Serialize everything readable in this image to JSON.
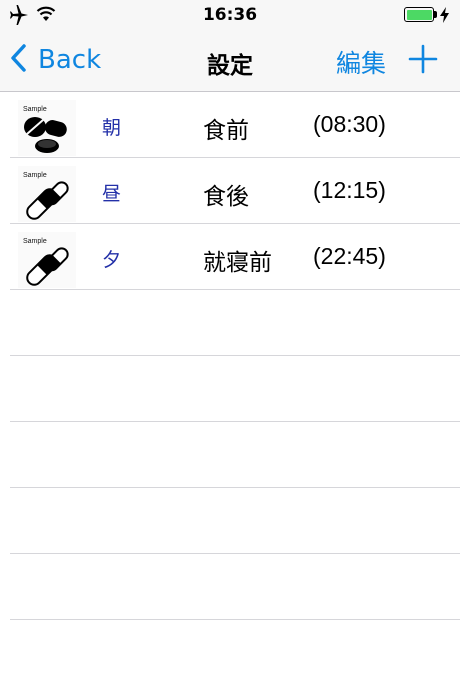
{
  "status_bar": {
    "time": "16:36",
    "icons": [
      "airplane-icon",
      "wifi-icon",
      "battery-icon",
      "charging-bolt-icon"
    ],
    "battery_color": "#4cd964"
  },
  "nav": {
    "back_label": "Back",
    "title": "設定",
    "edit_label": "編集",
    "add_icon": "plus-icon",
    "accent_color": "#0f86e0"
  },
  "list": {
    "rows": [
      {
        "thumb_label": "Sample",
        "thumb_icon": "tablets-icon",
        "slot": "朝",
        "timing": "食前",
        "time": "(08:30)"
      },
      {
        "thumb_label": "Sample",
        "thumb_icon": "capsule-icon",
        "slot": "昼",
        "timing": "食後",
        "time": "(12:15)"
      },
      {
        "thumb_label": "Sample",
        "thumb_icon": "capsule-icon",
        "slot": "夕",
        "timing": "就寝前",
        "time": "(22:45)"
      }
    ],
    "slot_color": "#2330a8"
  }
}
